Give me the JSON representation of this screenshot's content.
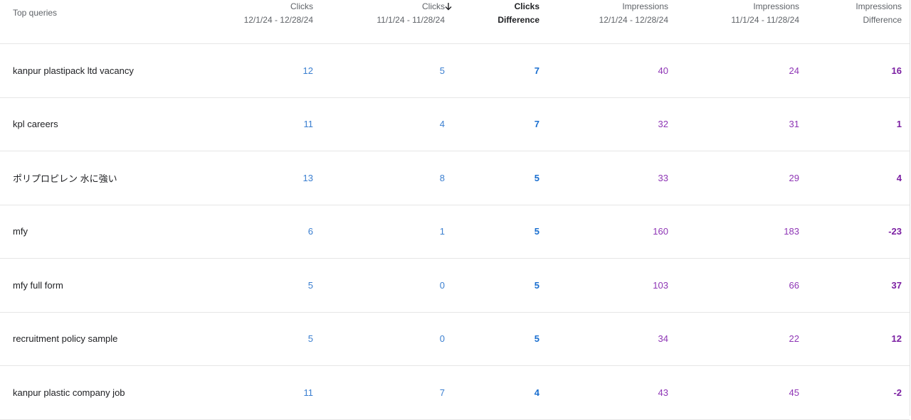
{
  "columns": {
    "query": {
      "label": "Top queries"
    },
    "clicks_current": {
      "label": "Clicks",
      "sublabel": "12/1/24 - 12/28/24"
    },
    "clicks_previous": {
      "label": "Clicks",
      "sublabel": "11/1/24 - 11/28/24"
    },
    "clicks_difference": {
      "label": "Clicks",
      "sublabel": "Difference",
      "sort_icon": "arrow-down-icon"
    },
    "impressions_current": {
      "label": "Impressions",
      "sublabel": "12/1/24 - 12/28/24"
    },
    "impressions_previous": {
      "label": "Impressions",
      "sublabel": "11/1/24 - 11/28/24"
    },
    "impressions_difference": {
      "label": "Impressions",
      "sublabel": "Difference"
    }
  },
  "rows": [
    {
      "query": "kanpur plastipack ltd vacancy",
      "clicks_current": "12",
      "clicks_previous": "5",
      "clicks_difference": "7",
      "impressions_current": "40",
      "impressions_previous": "24",
      "impressions_difference": "16"
    },
    {
      "query": "kpl careers",
      "clicks_current": "11",
      "clicks_previous": "4",
      "clicks_difference": "7",
      "impressions_current": "32",
      "impressions_previous": "31",
      "impressions_difference": "1"
    },
    {
      "query": "ポリプロピレン 水に強い",
      "clicks_current": "13",
      "clicks_previous": "8",
      "clicks_difference": "5",
      "impressions_current": "33",
      "impressions_previous": "29",
      "impressions_difference": "4"
    },
    {
      "query": "mfy",
      "clicks_current": "6",
      "clicks_previous": "1",
      "clicks_difference": "5",
      "impressions_current": "160",
      "impressions_previous": "183",
      "impressions_difference": "-23"
    },
    {
      "query": "mfy full form",
      "clicks_current": "5",
      "clicks_previous": "0",
      "clicks_difference": "5",
      "impressions_current": "103",
      "impressions_previous": "66",
      "impressions_difference": "37"
    },
    {
      "query": "recruitment policy sample",
      "clicks_current": "5",
      "clicks_previous": "0",
      "clicks_difference": "5",
      "impressions_current": "34",
      "impressions_previous": "22",
      "impressions_difference": "12"
    },
    {
      "query": "kanpur plastic company job",
      "clicks_current": "11",
      "clicks_previous": "7",
      "clicks_difference": "4",
      "impressions_current": "43",
      "impressions_previous": "45",
      "impressions_difference": "-2"
    }
  ],
  "colors": {
    "clicks": "#3b7fd0",
    "impressions": "#8e35b5",
    "row_border": "#e6e6e6"
  }
}
